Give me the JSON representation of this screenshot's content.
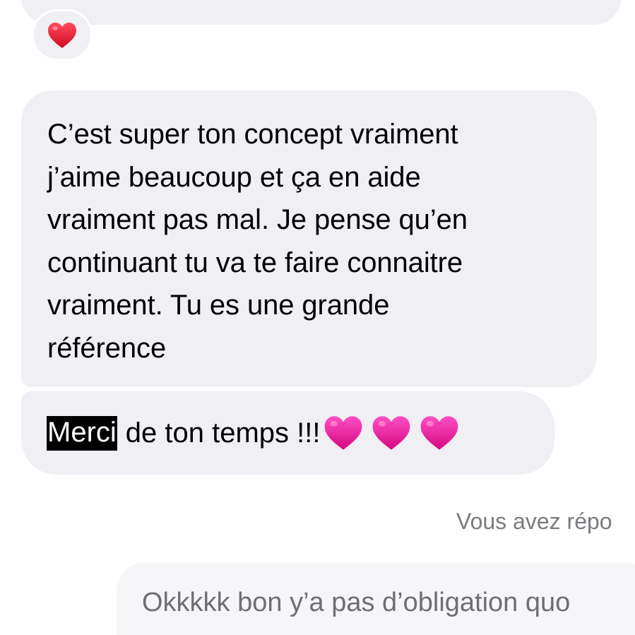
{
  "conversation": {
    "reaction": {
      "icon": "red-heart-icon",
      "color": "#e3122c"
    },
    "messages": [
      {
        "lines": [
          "C’est super ton concept vraiment",
          "j’aime beaucoup et ça en aide",
          "vraiment pas mal. Je pense qu’en",
          "continuant tu va te faire connaitre",
          "vraiment. Tu es une grande",
          "référence"
        ]
      },
      {
        "highlighted_word": "Merci",
        "rest": "de ton temps !!!",
        "emojis": [
          "pink-heart-icon",
          "pink-heart-icon",
          "pink-heart-icon"
        ],
        "emoji_color": "#e6119a"
      }
    ],
    "status_note": "Vous avez répo",
    "reply_preview": "Okkkkk bon y’a pas d’obligation quo"
  },
  "colors": {
    "incoming_bubble": "#efeff4",
    "status_text": "#7b7b80",
    "highlight_bg": "#000000"
  }
}
